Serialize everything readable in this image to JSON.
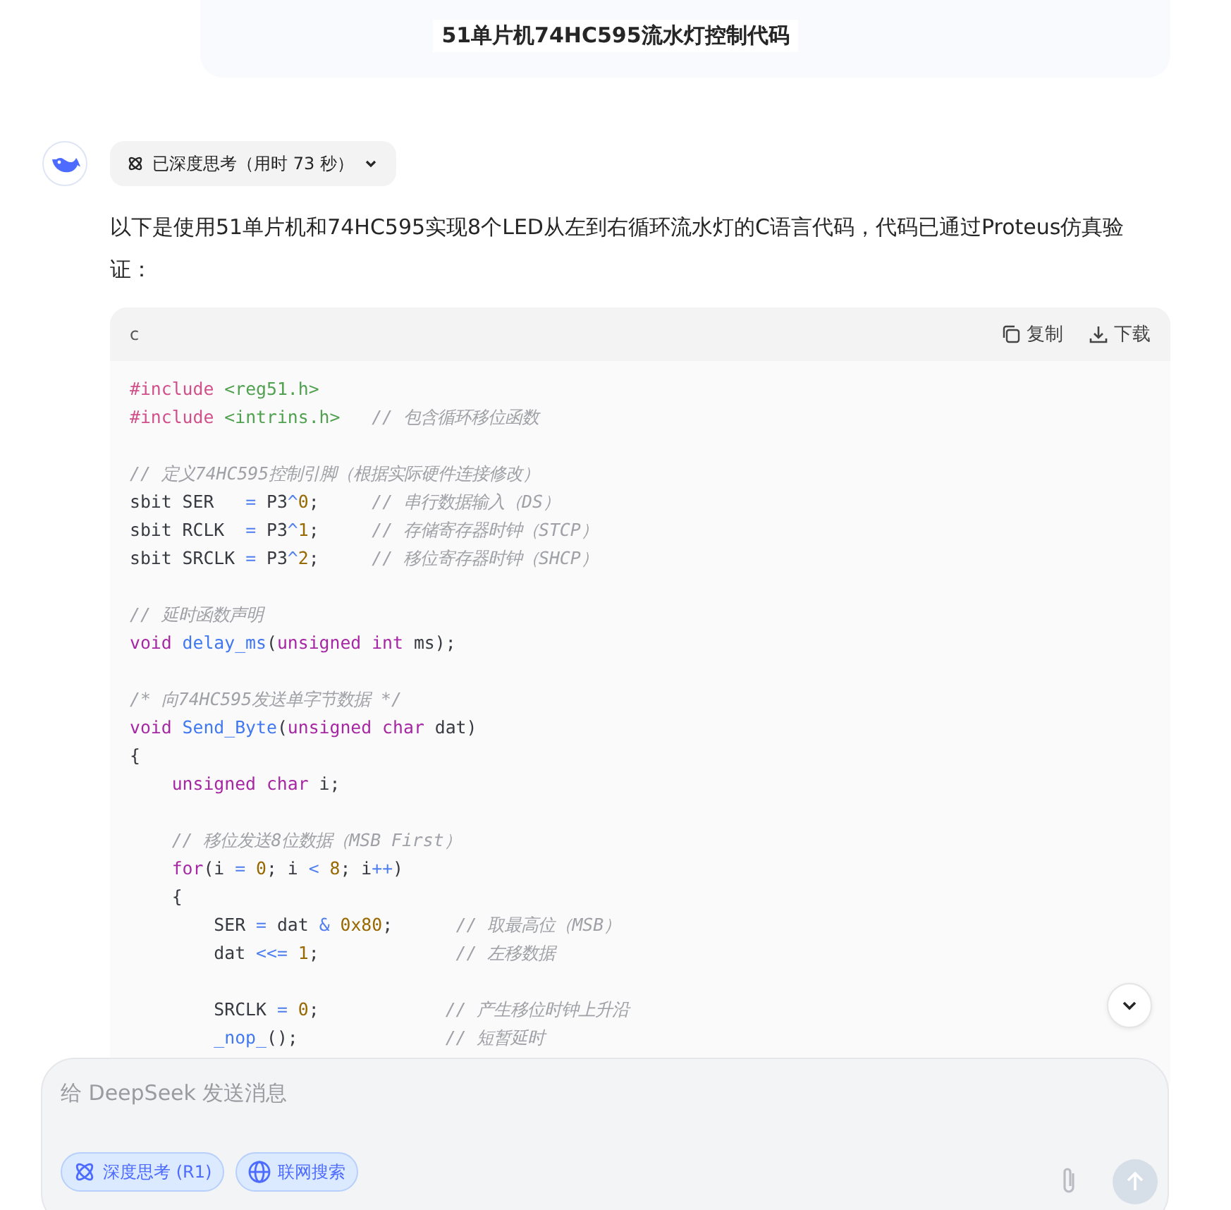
{
  "conversation_title": "51单片机74HC595流水灯控制代码",
  "thinking_chip": {
    "label": "已深度思考（用时 73 秒）"
  },
  "answer_intro": "以下是使用51单片机和74HC595实现8个LED从左到右循环流水灯的C语言代码，代码已通过Proteus仿真验证：",
  "code_block": {
    "language": "c",
    "actions": [
      "复制",
      "下载"
    ],
    "blocks": [
      [
        [
          {
            "text": "#include",
            "kind": "preproc"
          },
          {
            "text": " <reg51.h>",
            "kind": "string"
          }
        ],
        [
          {
            "text": "#include",
            "kind": "preproc"
          },
          {
            "text": " <intrins.h>",
            "kind": "string"
          },
          {
            "text": "   // 包含循环移位函数",
            "kind": "comment"
          }
        ]
      ],
      [
        [
          {
            "text": "// 定义74HC595控制引脚（根据实际硬件连接修改）",
            "kind": "comment"
          }
        ],
        [
          {
            "text": "sbit SER   ",
            "kind": "plain"
          },
          {
            "text": "=",
            "kind": "op"
          },
          {
            "text": " P3",
            "kind": "plain"
          },
          {
            "text": "^",
            "kind": "op"
          },
          {
            "text": "0",
            "kind": "number"
          },
          {
            "text": ";     ",
            "kind": "plain"
          },
          {
            "text": "// 串行数据输入（DS）",
            "kind": "comment"
          }
        ],
        [
          {
            "text": "sbit RCLK  ",
            "kind": "plain"
          },
          {
            "text": "=",
            "kind": "op"
          },
          {
            "text": " P3",
            "kind": "plain"
          },
          {
            "text": "^",
            "kind": "op"
          },
          {
            "text": "1",
            "kind": "number"
          },
          {
            "text": ";     ",
            "kind": "plain"
          },
          {
            "text": "// 存储寄存器时钟（STCP）",
            "kind": "comment"
          }
        ],
        [
          {
            "text": "sbit SRCLK ",
            "kind": "plain"
          },
          {
            "text": "=",
            "kind": "op"
          },
          {
            "text": " P3",
            "kind": "plain"
          },
          {
            "text": "^",
            "kind": "op"
          },
          {
            "text": "2",
            "kind": "number"
          },
          {
            "text": ";     ",
            "kind": "plain"
          },
          {
            "text": "// 移位寄存器时钟（SHCP）",
            "kind": "comment"
          }
        ]
      ],
      [
        [
          {
            "text": "// 延时函数声明",
            "kind": "comment"
          }
        ],
        [
          {
            "text": "void",
            "kind": "keyword"
          },
          {
            "text": " delay_ms",
            "kind": "function"
          },
          {
            "text": "(",
            "kind": "plain"
          },
          {
            "text": "unsigned int",
            "kind": "keyword"
          },
          {
            "text": " ms);",
            "kind": "plain"
          }
        ]
      ],
      [
        [
          {
            "text": "/* 向74HC595发送单字节数据 */",
            "kind": "comment"
          }
        ],
        [
          {
            "text": "void",
            "kind": "keyword"
          },
          {
            "text": " Send_Byte",
            "kind": "function"
          },
          {
            "text": "(",
            "kind": "plain"
          },
          {
            "text": "unsigned char",
            "kind": "keyword"
          },
          {
            "text": " dat)",
            "kind": "plain"
          }
        ],
        [
          {
            "text": "{",
            "kind": "plain"
          }
        ],
        [
          {
            "text": "    unsigned char",
            "kind": "keyword"
          },
          {
            "text": " i;",
            "kind": "plain"
          }
        ]
      ],
      [
        [
          {
            "text": "    // 移位发送8位数据（MSB First）",
            "kind": "comment"
          }
        ],
        [
          {
            "text": "    for",
            "kind": "keyword"
          },
          {
            "text": "(i ",
            "kind": "plain"
          },
          {
            "text": "=",
            "kind": "op"
          },
          {
            "text": " 0",
            "kind": "number"
          },
          {
            "text": "; i ",
            "kind": "plain"
          },
          {
            "text": "<",
            "kind": "op"
          },
          {
            "text": " 8",
            "kind": "number"
          },
          {
            "text": "; i",
            "kind": "plain"
          },
          {
            "text": "++",
            "kind": "op"
          },
          {
            "text": ")",
            "kind": "plain"
          }
        ],
        [
          {
            "text": "    {",
            "kind": "plain"
          }
        ],
        [
          {
            "text": "        SER ",
            "kind": "plain"
          },
          {
            "text": "=",
            "kind": "op"
          },
          {
            "text": " dat ",
            "kind": "plain"
          },
          {
            "text": "&",
            "kind": "op"
          },
          {
            "text": " 0x80",
            "kind": "number"
          },
          {
            "text": ";      ",
            "kind": "plain"
          },
          {
            "text": "// 取最高位（MSB）",
            "kind": "comment"
          }
        ],
        [
          {
            "text": "        dat ",
            "kind": "plain"
          },
          {
            "text": "<<=",
            "kind": "op"
          },
          {
            "text": " 1",
            "kind": "number"
          },
          {
            "text": ";             ",
            "kind": "plain"
          },
          {
            "text": "// 左移数据",
            "kind": "comment"
          }
        ]
      ],
      [
        [
          {
            "text": "        SRCLK ",
            "kind": "plain"
          },
          {
            "text": "=",
            "kind": "op"
          },
          {
            "text": " 0",
            "kind": "number"
          },
          {
            "text": ";            ",
            "kind": "plain"
          },
          {
            "text": "// 产生移位时钟上升沿",
            "kind": "comment"
          }
        ],
        [
          {
            "text": "        _nop_",
            "kind": "function"
          },
          {
            "text": "();              ",
            "kind": "plain"
          },
          {
            "text": "// 短暂延时",
            "kind": "comment"
          }
        ]
      ]
    ]
  },
  "composer": {
    "placeholder": "给 DeepSeek 发送消息",
    "toggles": [
      {
        "label": "深度思考 (R1)",
        "kind": "think",
        "selected": true
      },
      {
        "label": "联网搜索",
        "kind": "web",
        "selected": true
      }
    ]
  }
}
